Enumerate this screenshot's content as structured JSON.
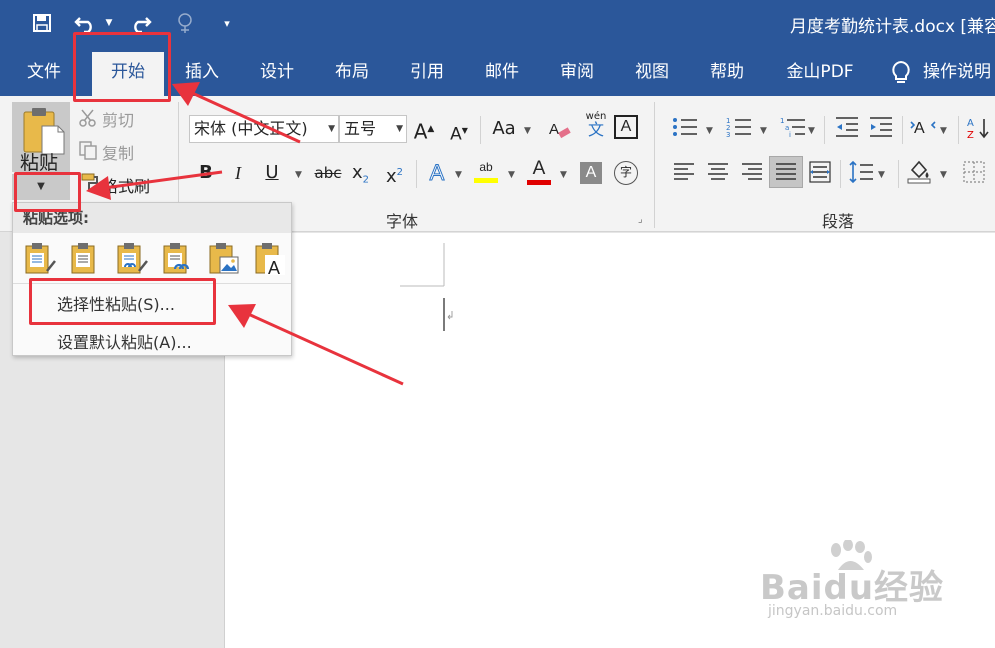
{
  "title_bar": {
    "document_title": "月度考勤统计表.docx [兼容",
    "quick_access": [
      "save-icon",
      "undo-icon",
      "redo-icon",
      "touch-mode-icon",
      "customize-qat-icon"
    ]
  },
  "tabs": [
    {
      "label": "文件"
    },
    {
      "label": "开始",
      "active": true
    },
    {
      "label": "插入"
    },
    {
      "label": "设计"
    },
    {
      "label": "布局"
    },
    {
      "label": "引用"
    },
    {
      "label": "邮件"
    },
    {
      "label": "审阅"
    },
    {
      "label": "视图"
    },
    {
      "label": "帮助"
    },
    {
      "label": "金山PDF"
    }
  ],
  "tell_me": {
    "label": "操作说明"
  },
  "clipboard": {
    "paste_label": "粘贴",
    "cut_label": "剪切",
    "copy_label": "复制",
    "format_painter_label": "格式刷"
  },
  "font_group": {
    "label": "字体",
    "font_name": "宋体 (中文正文)",
    "font_size": "五号",
    "change_case": "Aa",
    "bold": "B",
    "italic": "I",
    "underline": "U",
    "strikethrough": "abc",
    "subscript": "x",
    "superscript": "x",
    "phonetic": "wén",
    "phonetic_char": "文",
    "enclose": "字"
  },
  "paragraph_group": {
    "label": "段落"
  },
  "paste_menu": {
    "header": "粘贴选项:",
    "items": [
      {
        "label": "选择性粘贴(S)..."
      },
      {
        "label": "设置默认粘贴(A)..."
      }
    ]
  },
  "watermark": {
    "main": "Baidu经验",
    "sub": "jingyan.baidu.com"
  },
  "colors": {
    "title_bar": "#2b579a",
    "ribbon": "#f3f3f3",
    "annotation_red": "#e8333d",
    "highlight_yellow": "#ffff00",
    "font_color_red": "#e00000"
  }
}
